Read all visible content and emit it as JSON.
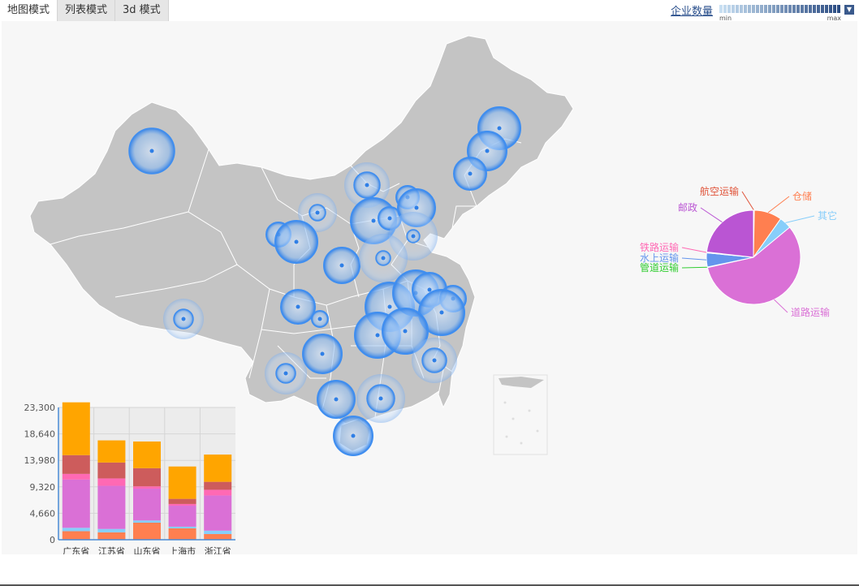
{
  "tabs": [
    {
      "label": "地图模式",
      "active": true
    },
    {
      "label": "列表模式",
      "active": false
    },
    {
      "label": "3d 模式",
      "active": false
    }
  ],
  "legend": {
    "title": "企业数量",
    "min_label": "min",
    "max_label": "max",
    "color_low": "#c8dff2",
    "color_high": "#2c4d83"
  },
  "colors": {
    "map_fill": "#c4c4c4",
    "map_border": "#ffffff",
    "bubble": "#3f8ef0",
    "background": "#f7f7f7"
  },
  "chart_data": [
    {
      "type": "pie",
      "labels": [
        "航空运输",
        "仓储",
        "其它",
        "道路运输",
        "管道运输",
        "水上运输",
        "铁路运输",
        "邮政"
      ],
      "values": [
        0.3,
        9.5,
        4.2,
        57.5,
        0.2,
        4.8,
        0.3,
        23.2
      ],
      "colors": [
        "#e0543a",
        "#ff7f50",
        "#87cefa",
        "#da70d6",
        "#32cd32",
        "#6495ed",
        "#ff69b4",
        "#ba55d3"
      ],
      "label_colors": [
        "#e0543a",
        "#ff7f50",
        "#87cefa",
        "#da70d6",
        "#32cd32",
        "#6495ed",
        "#ff69b4",
        "#ba55d3"
      ]
    },
    {
      "type": "bar",
      "stacked": true,
      "categories": [
        "广东省",
        "江苏省",
        "山东省",
        "上海市",
        "浙江省"
      ],
      "ylim": [
        0,
        23300
      ],
      "yticks": [
        "0",
        "4,660",
        "9,320",
        "13,980",
        "18,640",
        "23,300"
      ],
      "series": [
        {
          "color": "#ff7f50",
          "values": [
            1500,
            1300,
            3000,
            2000,
            1000
          ]
        },
        {
          "color": "#87cefa",
          "values": [
            600,
            600,
            400,
            300,
            600
          ]
        },
        {
          "color": "#da70d6",
          "values": [
            8500,
            7600,
            5600,
            3700,
            6200
          ]
        },
        {
          "color": "#ff69b4",
          "values": [
            1000,
            1300,
            400,
            300,
            1000
          ]
        },
        {
          "color": "#cd5c5c",
          "values": [
            3300,
            2800,
            3200,
            900,
            1400
          ]
        },
        {
          "color": "#ffa500",
          "values": [
            9300,
            3900,
            4700,
            5700,
            4800
          ]
        }
      ]
    }
  ]
}
